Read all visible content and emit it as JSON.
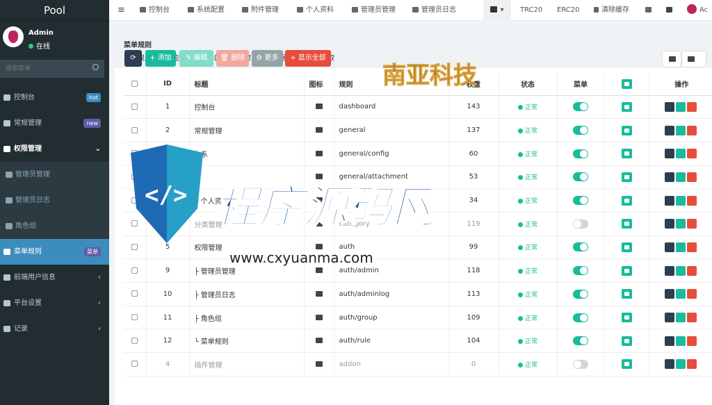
{
  "sidebar": {
    "logo": "Pool",
    "user_name": "Admin",
    "user_status": "在线",
    "search_placeholder": "搜索菜单",
    "items": [
      {
        "label": "控制台",
        "badge": "hot",
        "badge_color": "#3c8dbc"
      },
      {
        "label": "常规管理",
        "badge": "new",
        "badge_color": "#605ca8"
      },
      {
        "label": "权限管理",
        "chevron": "⌄"
      },
      {
        "label": "管理员管理"
      },
      {
        "label": "管理员日志"
      },
      {
        "label": "角色组"
      },
      {
        "label": "菜单规则",
        "badge": "菜单",
        "badge_color": "#605ca8"
      },
      {
        "label": "前端用户信息",
        "chevron": "‹"
      },
      {
        "label": "平台设置",
        "chevron": "‹"
      },
      {
        "label": "记录",
        "chevron": "‹"
      }
    ]
  },
  "topnav": {
    "hamburger": "≡",
    "items": [
      "控制台",
      "系统配置",
      "附件管理",
      "个人资料",
      "管理员管理",
      "管理员日志"
    ],
    "menu_toggle": "▾",
    "trc20": "TRC20",
    "erc20": "ERC20",
    "clear_cache": "清除缓存",
    "user_short": "Ac"
  },
  "banner": {
    "title": "菜单规则",
    "desc": "菜单规则通常对应一个控制器的方法,同时菜单栏数据也从规则中获取"
  },
  "toolbar": {
    "refresh": "⟳",
    "add": "+ 添加",
    "edit": "✎ 编辑",
    "delete": "🗑 删除",
    "more": "⚙ 更多",
    "show_all": "+ 显示全部"
  },
  "table": {
    "headers": [
      "ID",
      "标题",
      "图标",
      "规则",
      "权重",
      "状态",
      "菜单",
      "^",
      "操作"
    ],
    "rows": [
      {
        "id": "1",
        "title": "控制台",
        "rule": "dashboard",
        "weight": "143",
        "status": "正常",
        "menu": true,
        "dim": false
      },
      {
        "id": "2",
        "title": "常规管理",
        "rule": "general",
        "weight": "137",
        "status": "正常",
        "menu": true,
        "dim": false
      },
      {
        "id": "",
        "title": "├ 系",
        "rule": "general/config",
        "weight": "60",
        "status": "正常",
        "menu": true,
        "dim": false
      },
      {
        "id": "",
        "title": "├",
        "rule": "general/attachment",
        "weight": "53",
        "status": "正常",
        "menu": true,
        "dim": false
      },
      {
        "id": "8",
        "title": "└ 个人资",
        "rule": "",
        "weight": "34",
        "status": "正常",
        "menu": true,
        "dim": false
      },
      {
        "id": "3",
        "title": "分类管理",
        "rule": "category",
        "weight": "119",
        "status": "正常",
        "menu": false,
        "dim": true
      },
      {
        "id": "5",
        "title": "权限管理",
        "rule": "auth",
        "weight": "99",
        "status": "正常",
        "menu": true,
        "dim": false
      },
      {
        "id": "9",
        "title": "├ 管理员管理",
        "rule": "auth/admin",
        "weight": "118",
        "status": "正常",
        "menu": true,
        "dim": false
      },
      {
        "id": "10",
        "title": "├ 管理员日志",
        "rule": "auth/adminlog",
        "weight": "113",
        "status": "正常",
        "menu": true,
        "dim": false
      },
      {
        "id": "11",
        "title": "├ 角色组",
        "rule": "auth/group",
        "weight": "109",
        "status": "正常",
        "menu": true,
        "dim": false
      },
      {
        "id": "12",
        "title": "└ 菜单规则",
        "rule": "auth/rule",
        "weight": "104",
        "status": "正常",
        "menu": true,
        "dim": false
      },
      {
        "id": "4",
        "title": "插件管理",
        "rule": "addon",
        "weight": "0",
        "status": "正常",
        "menu": false,
        "dim": true
      }
    ]
  },
  "watermark": {
    "logo_text": "南亚科技",
    "site_name": "程序源码网",
    "site_url": "www.cxyuanma.com"
  },
  "colors": {
    "sidebar_bg": "#222d32",
    "active": "#3c8dbc",
    "success": "#18bc9c",
    "danger": "#e74c3c",
    "dark_btn": "#2c3e50"
  }
}
